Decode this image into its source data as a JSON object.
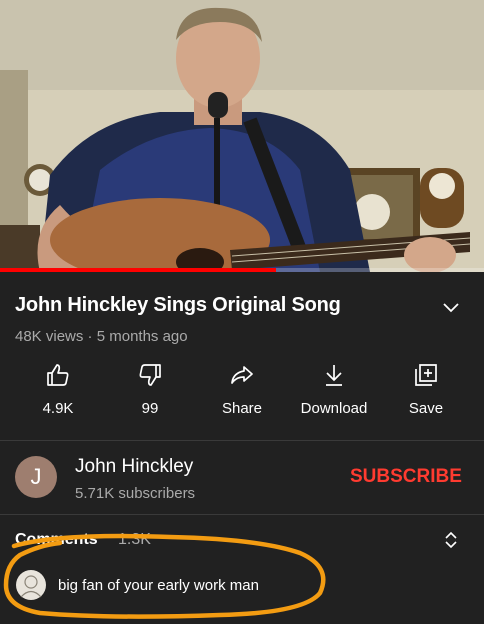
{
  "video": {
    "progress_fraction": 0.57
  },
  "info": {
    "title": "John Hinckley Sings Original Song",
    "views": "48K views",
    "separator": " · ",
    "age": "5 months ago"
  },
  "actions": [
    {
      "label": "4.9K",
      "icon": "thumbs-up-icon"
    },
    {
      "label": "99",
      "icon": "thumbs-down-icon"
    },
    {
      "label": "Share",
      "icon": "share-icon"
    },
    {
      "label": "Download",
      "icon": "download-icon"
    },
    {
      "label": "Save",
      "icon": "save-to-playlist-icon"
    }
  ],
  "channel": {
    "avatar_letter": "J",
    "name": "John Hinckley",
    "subscribers": "5.71K subscribers",
    "subscribe_label": "SUBSCRIBE"
  },
  "comments": {
    "heading": "Comments",
    "count": "1.3K",
    "top_comment": "big fan of your early work man"
  },
  "colors": {
    "background": "#212121",
    "accent": "#ff0000",
    "subscribe": "#ff3b30",
    "highlight": "#f39c12",
    "secondary_text": "#aaaaaa"
  }
}
